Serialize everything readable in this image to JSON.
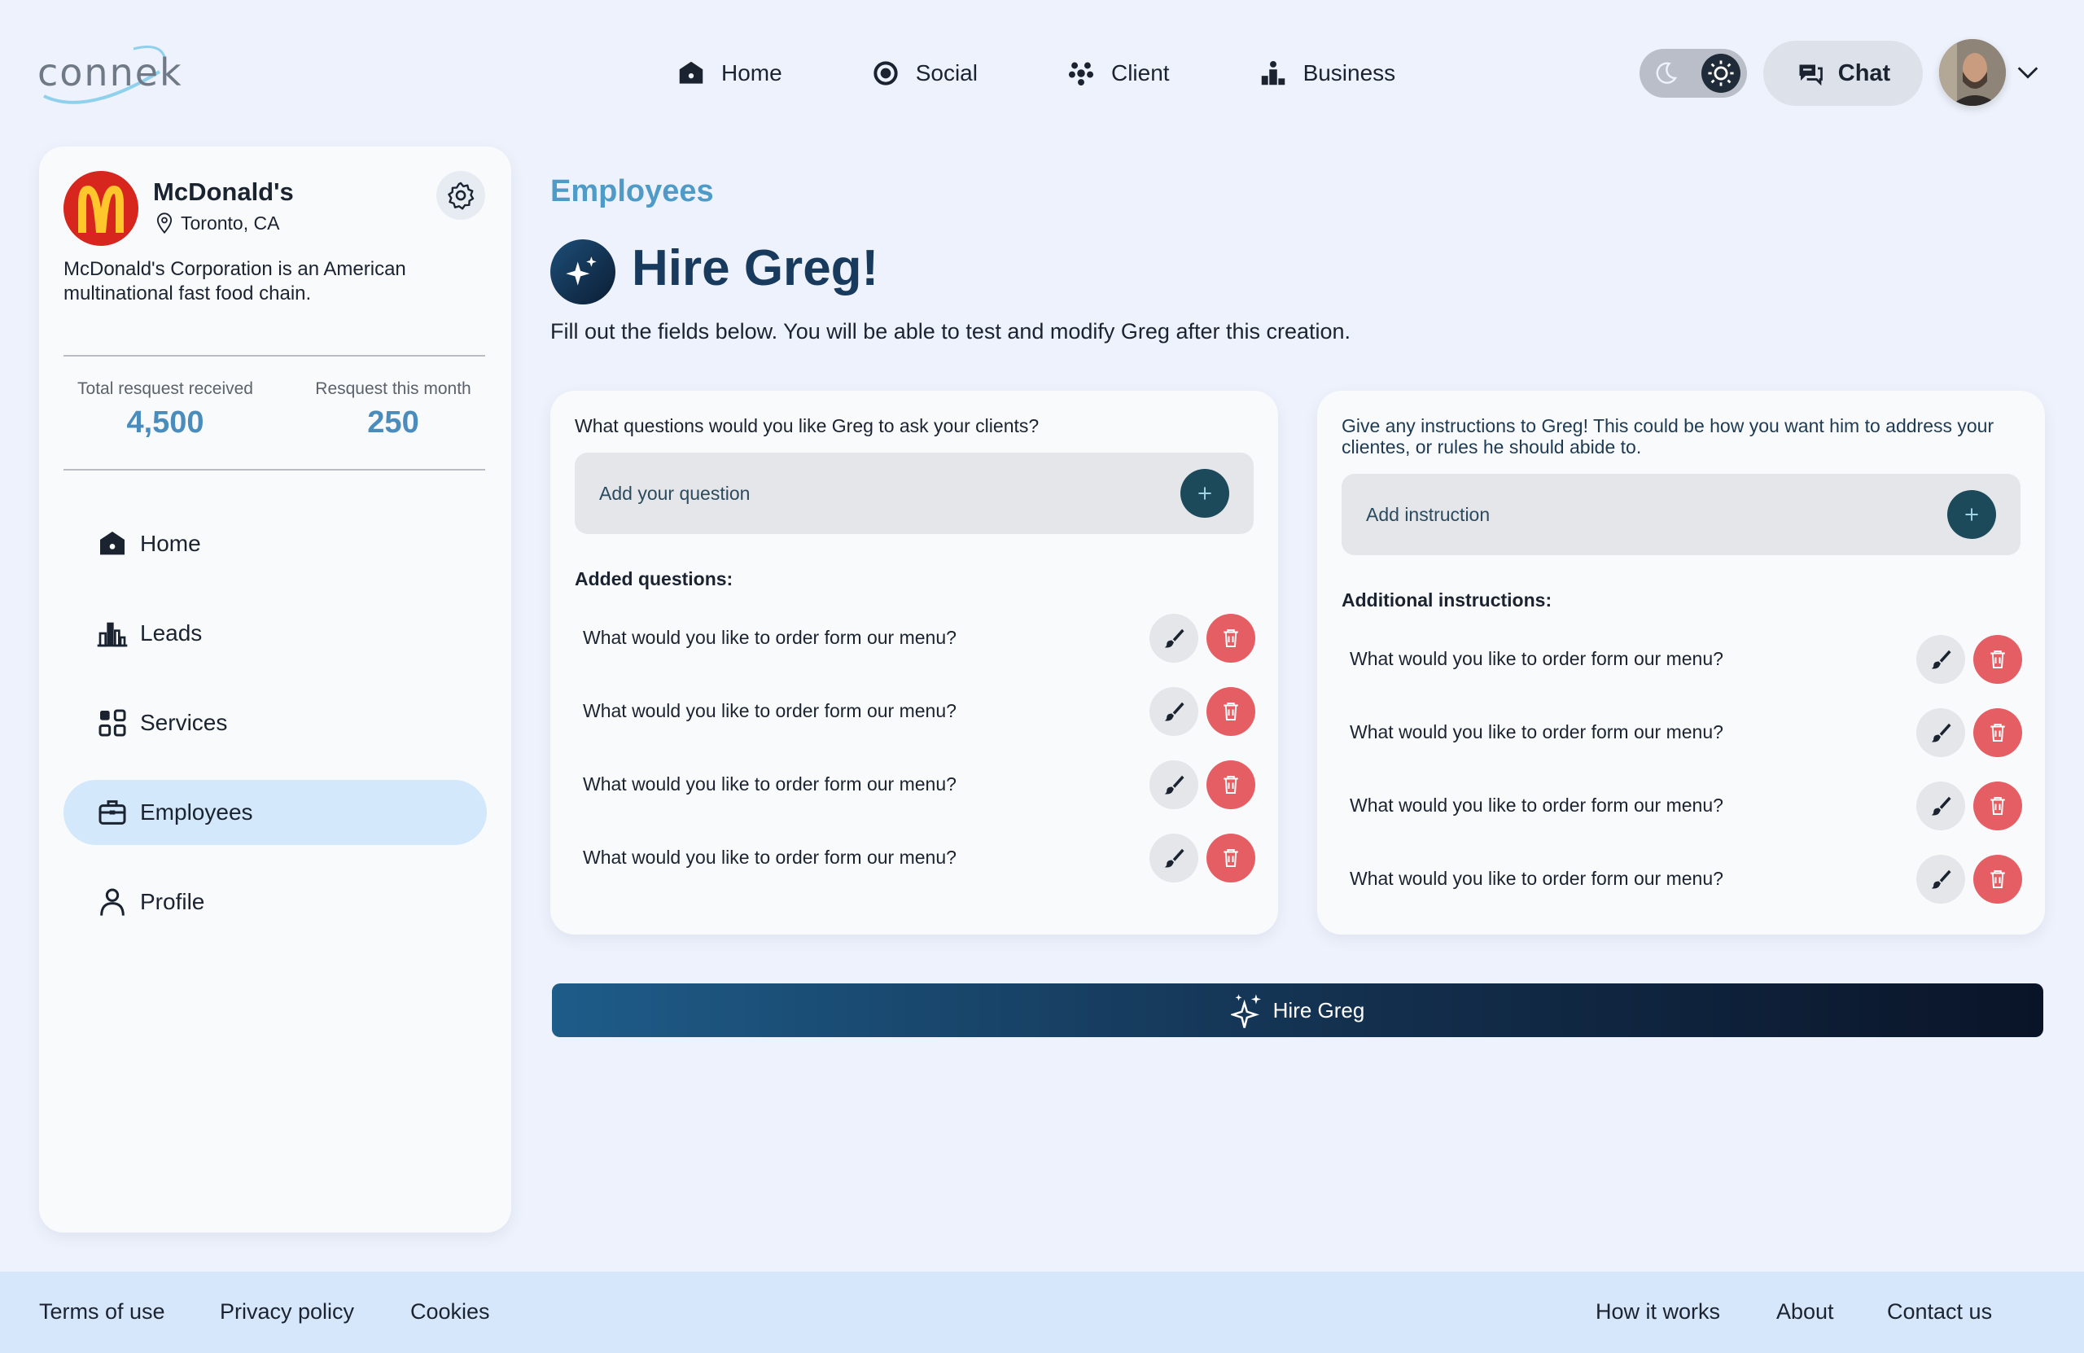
{
  "header": {
    "logo_text": "connek",
    "nav": [
      {
        "label": "Home",
        "icon": "home-icon"
      },
      {
        "label": "Social",
        "icon": "social-icon"
      },
      {
        "label": "Client",
        "icon": "client-icon"
      },
      {
        "label": "Business",
        "icon": "business-icon"
      }
    ],
    "chat_label": "Chat"
  },
  "sidebar": {
    "brand_name": "McDonald's",
    "brand_location": "Toronto, CA",
    "brand_description": "McDonald's Corporation is an American multinational fast food chain.",
    "stats": [
      {
        "label": "Total resquest received",
        "value": "4,500"
      },
      {
        "label": "Resquest this month",
        "value": "250"
      }
    ],
    "items": [
      {
        "label": "Home",
        "icon": "home-icon"
      },
      {
        "label": "Leads",
        "icon": "leads-chart-icon"
      },
      {
        "label": "Services",
        "icon": "services-grid-icon"
      },
      {
        "label": "Employees",
        "icon": "briefcase-icon",
        "active": true
      },
      {
        "label": "Profile",
        "icon": "person-icon"
      }
    ]
  },
  "main": {
    "section_title": "Employees",
    "hire_title": "Hire Greg!",
    "hire_subtitle": "Fill out the fields below. You will be able to test and modify Greg after this creation.",
    "questions_card": {
      "prompt": "What questions would you like Greg to ask your clients?",
      "input_placeholder": "Add your question",
      "list_title": "Added questions:",
      "items": [
        "What would you like to order form our menu?",
        "What would you like to order form our menu?",
        "What would you like to order form our menu?",
        "What would you like to order form our menu?"
      ]
    },
    "instructions_card": {
      "prompt": "Give any instructions to Greg! This could be how you want him to address your clientes, or rules he should abide to.",
      "input_placeholder": "Add instruction",
      "list_title": "Additional instructions:",
      "items": [
        "What would you like to order form our menu?",
        "What would you like to order form our menu?",
        "What would you like to order form our menu?",
        "What would you like to order form our menu?"
      ]
    },
    "hire_button_label": "Hire Greg"
  },
  "footer": {
    "left_links": [
      "Terms of use",
      "Privacy policy",
      "Cookies"
    ],
    "right_links": [
      "How it works",
      "About",
      "Contact us"
    ]
  },
  "colors": {
    "accent_blue": "#4f9bc8",
    "title_navy": "#183a5c",
    "delete_red": "#e45e63",
    "active_nav_bg": "#d3e8fb",
    "footer_bg": "#d6e6fb"
  }
}
